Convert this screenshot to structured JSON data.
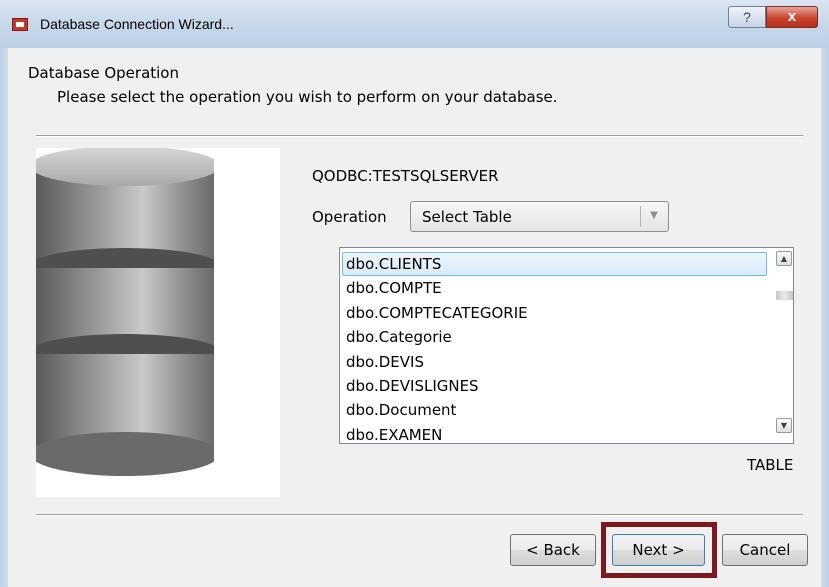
{
  "window": {
    "title": "Database Connection Wizard...",
    "help_label": "?",
    "close_label": "x"
  },
  "header": {
    "title": "Database Operation",
    "subtitle": "Please select the operation you wish to perform on your database."
  },
  "connection": {
    "name": "QODBC:TESTSQLSERVER"
  },
  "operation": {
    "label": "Operation",
    "selected": "Select Table"
  },
  "tables": {
    "items": [
      "dbo.CLIENTS",
      "dbo.COMPTE",
      "dbo.COMPTECATEGORIE",
      "dbo.Categorie",
      "dbo.DEVIS",
      "dbo.DEVISLIGNES",
      "dbo.Document",
      "dbo.EXAMEN"
    ],
    "selected_index": 0,
    "type_label": "TABLE"
  },
  "buttons": {
    "back": "< Back",
    "next": "Next >",
    "cancel": "Cancel"
  },
  "colors": {
    "highlight_border": "#7a1a1e",
    "selection_border": "#7eb4ea"
  }
}
